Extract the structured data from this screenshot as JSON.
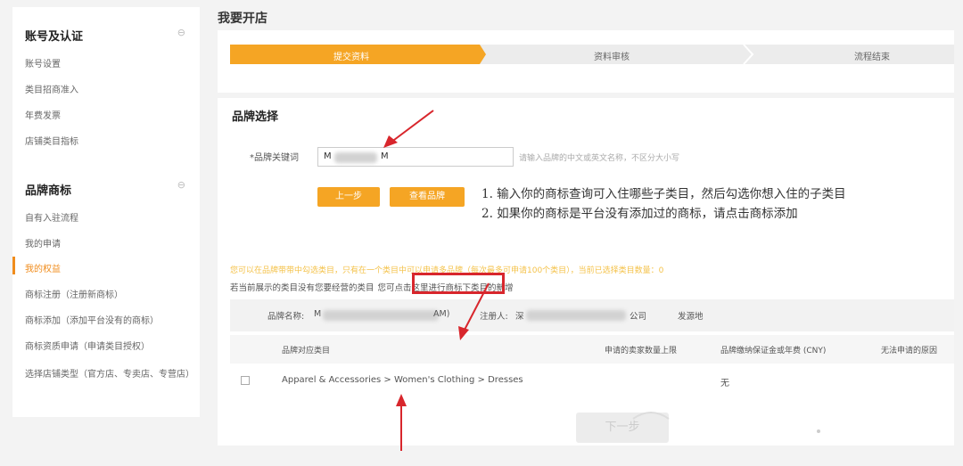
{
  "page_title": "我要开店",
  "sidebar": {
    "sections": [
      {
        "title": "账号及认证",
        "items": [
          "账号设置",
          "类目招商准入",
          "年费发票",
          "店铺类目指标"
        ]
      },
      {
        "title": "品牌商标",
        "items": [
          "自有入驻流程",
          "我的申请",
          "我的权益",
          "商标注册（注册新商标）",
          "商标添加（添加平台没有的商标）",
          "商标资质申请（申请类目授权）",
          "选择店铺类型（官方店、专卖店、专营店）"
        ]
      }
    ],
    "active_item": "我的权益"
  },
  "stepper": {
    "steps": [
      "提交资料",
      "资料审核",
      "流程结束"
    ],
    "active_index": 0
  },
  "brand_select": {
    "heading": "品牌选择",
    "field_label": "*品牌关键词",
    "field_value_prefix": "M",
    "field_value_suffix": "M",
    "field_hint": "请输入品牌的中文或英文名称，不区分大小写",
    "prev_button": "上一步",
    "query_button": "查看品牌"
  },
  "instructions": [
    "1. 输入你的商标查询可入住哪些子类目，然后勾选你想入住的子类目",
    "2. 如果你的商标是平台没有添加过的商标，请点击商标添加"
  ],
  "notice": "您可以在品牌带带中勾选类目，只有在一个类目中可以申请多品牌（每次最多可申请100个类目），当前已选择类目数量：0",
  "notice2_prefix": "若当前展示的类目没有您要经营的类目",
  "notice2_link": "您可点击这里进行",
  "notice2_suffix": "商标下类目的新增",
  "brand_info": {
    "name_label": "品牌名称:",
    "name_prefix": "M",
    "name_suffix": "AM)",
    "registrant_label": "注册人:",
    "registrant_prefix": "深",
    "registrant_suffix": "公司",
    "origin_label": "发源地"
  },
  "table": {
    "columns": [
      "品牌对应类目",
      "申请的卖家数量上限",
      "品牌缴纳保证金或年费 (CNY)",
      "无法申请的原因"
    ],
    "rows": [
      {
        "category": "Apparel & Accessories > Women's Clothing > Dresses",
        "value": "无"
      }
    ]
  },
  "next_button": "下一步",
  "colors": {
    "accent": "#f5a524",
    "annotation_red": "#d8262c"
  }
}
